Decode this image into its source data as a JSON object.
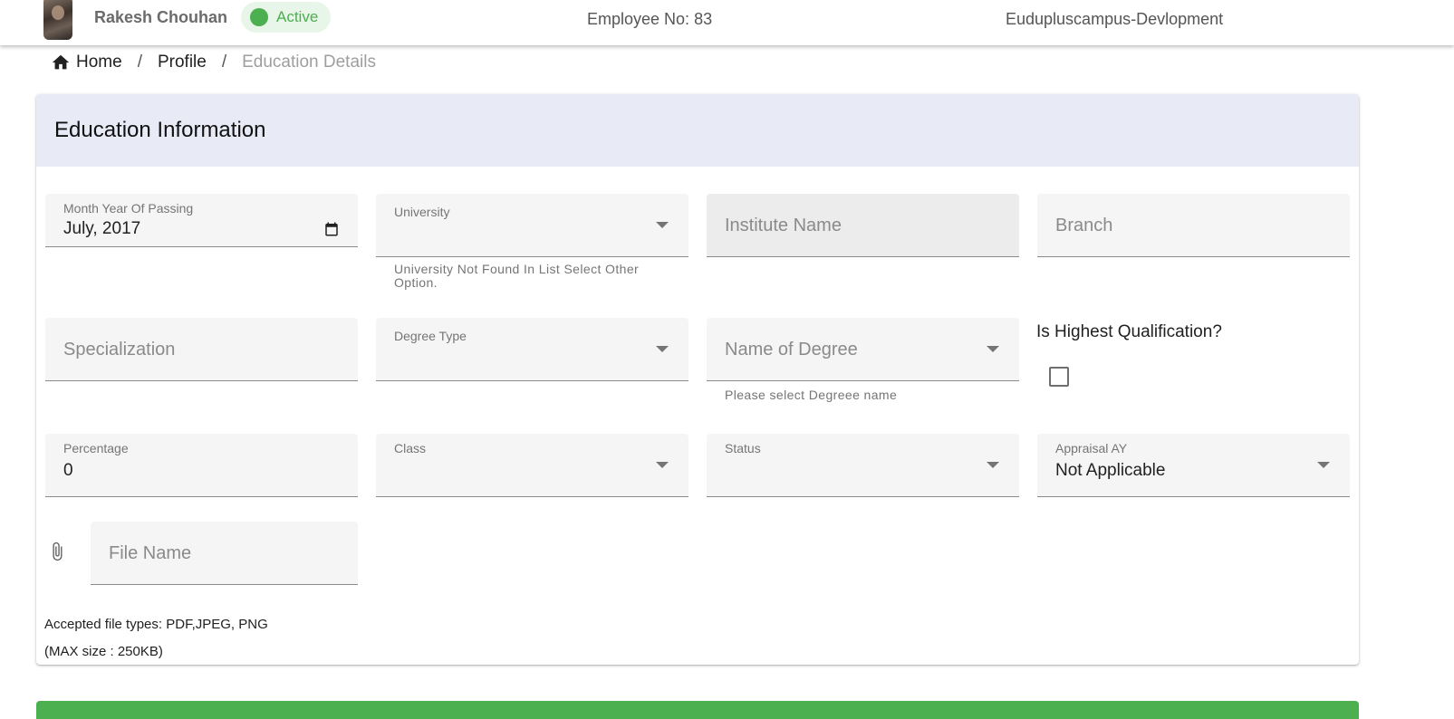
{
  "header": {
    "user_name": "Rakesh Chouhan",
    "status": "Active",
    "employee_label": "Employee No:",
    "employee_no": "83",
    "org_name": "Eudupluscampus-Devlopment"
  },
  "breadcrumb": {
    "home": "Home",
    "separator": "/",
    "profile": "Profile",
    "current": "Education Details"
  },
  "card": {
    "title": "Education Information"
  },
  "form": {
    "month_year": {
      "label": "Month Year Of Passing",
      "value": "July, 2017"
    },
    "university": {
      "label": "University",
      "hint": "University Not Found In List Select Other Option."
    },
    "institute": {
      "placeholder": "Institute Name"
    },
    "branch": {
      "placeholder": "Branch"
    },
    "specialization": {
      "placeholder": "Specialization"
    },
    "degree_type": {
      "label": "Degree Type"
    },
    "degree_name": {
      "placeholder": "Name of Degree",
      "hint": "Please select Degreee name"
    },
    "highest_qualification": {
      "label": "Is Highest Qualification?",
      "checked": false
    },
    "percentage": {
      "label": "Percentage",
      "value": "0"
    },
    "class": {
      "label": "Class"
    },
    "status": {
      "label": "Status"
    },
    "appraisal": {
      "label": "Appraisal AY",
      "value": "Not Applicable"
    },
    "file": {
      "placeholder": "File Name"
    }
  },
  "notes": {
    "file_types": "Accepted file types: PDF,JPEG, PNG",
    "max_size": "(MAX size : 250KB)"
  },
  "colors": {
    "accent_green": "#4caf50",
    "header_band": "#e8eaf6",
    "field_bg": "#f5f5f5"
  }
}
